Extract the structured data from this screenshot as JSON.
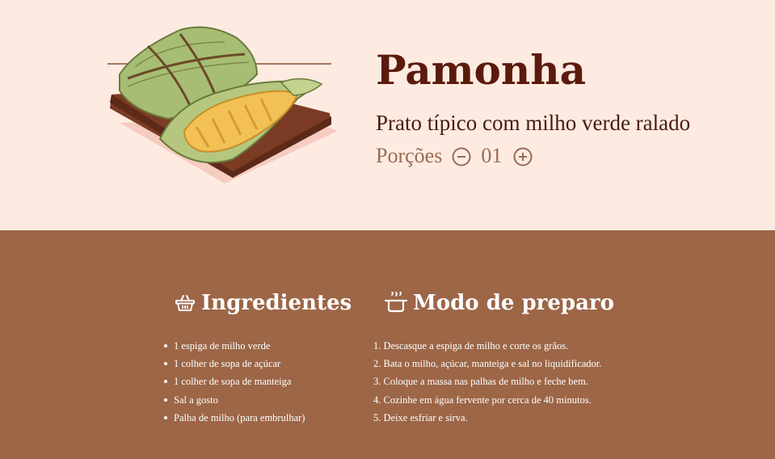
{
  "recipe": {
    "title": "Pamonha",
    "subtitle": "Prato típico com milho verde ralado",
    "servings_label": "Porções",
    "servings_count": "01"
  },
  "ingredients": {
    "title": "Ingredientes",
    "icon": "basket-icon",
    "items": [
      "1 espiga de milho verde",
      "1 colher de sopa de açúcar",
      "1 colher de sopa de manteiga",
      "Sal a gosto",
      "Palha de milho (para embrulhar)"
    ]
  },
  "preparation": {
    "title": "Modo de preparo",
    "icon": "cooking-pot-icon",
    "steps": [
      "1. Descasque a espiga de milho e corte os grãos.",
      "2. Bata o milho, açúcar, manteiga e sal no liquidificador.",
      "3. Coloque a massa nas palhas de milho e feche bem.",
      "4. Cozinhe em água fervente por cerca de 40 minutos.",
      "5. Deixe esfriar e sirva."
    ]
  },
  "colors": {
    "hero_background": "#fdebe1",
    "content_background": "#9c6647",
    "title": "#5a1a0c",
    "accent": "#9a6b52"
  }
}
